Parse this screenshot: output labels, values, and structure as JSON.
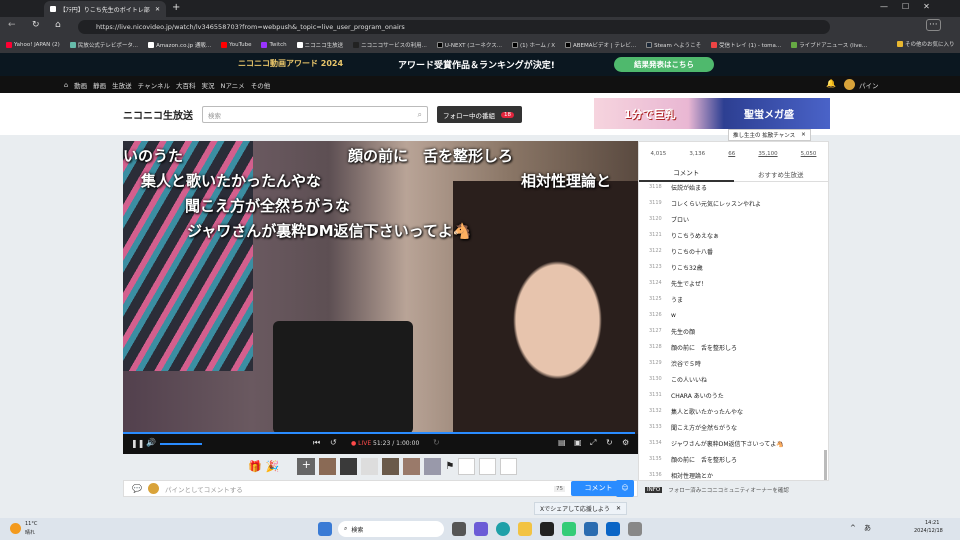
{
  "browser": {
    "tab_title": "【ｱﾃ円】りこち先生のボイトレ部",
    "url": "https://live.nicovideo.jp/watch/lv346558703?from=webpush&_topic=live_user_program_onairs",
    "bookmarks": [
      "Yahoo! JAPAN (2)",
      "民放公式テレビポータ...",
      "Amazon.co.jp 通販...",
      "YouTube",
      "Twitch",
      "ニコニコ生放送",
      "ニコニコサービスの利用...",
      "U-NEXT (ユーネクス...",
      "(1) ホーム / X",
      "ABEMAビデオ | テレビ...",
      "Steam へようこそ",
      "受信トレイ (1) - toma...",
      "ライブドアニュース (live..."
    ],
    "bookmarks_folder": "その他のお気に入り"
  },
  "banner": {
    "left": "ニコニコ動画アワード 2024",
    "center": "アワード受賞作品＆ランキングが決定!",
    "button": "結果発表はこちら"
  },
  "nav": {
    "items": [
      "動画",
      "静画",
      "生放送",
      "チャンネル",
      "大百科",
      "実況",
      "Nアニメ",
      "その他"
    ],
    "user": "パイン"
  },
  "header": {
    "logo": "ニコニコ生放送",
    "search_placeholder": "検索",
    "follow_label": "フォロー中の番組",
    "follow_count": "18",
    "ad_left": "1分で巨乳",
    "ad_right": "聖蛍メガ盛"
  },
  "captions": [
    "いのうた",
    "顔の前に　舌を整形しろ",
    "集人と歌いたかったんやな",
    "相対性理論と",
    "聞こえ方が全然ちがうな",
    "ジャワさんが裏粋DM返信下さいってよ🐴"
  ],
  "player": {
    "live": "LIVE",
    "time": "51:23 / 1:00:00"
  },
  "tooltip": "推し生主の 拡散チャンス",
  "stats": [
    "4,015",
    "3,136",
    "66",
    "35,100",
    "5,050"
  ],
  "tabs": [
    "コメント",
    "おすすめ生放送"
  ],
  "comments": [
    {
      "n": "3118",
      "t": "伝説が始まる"
    },
    {
      "n": "3119",
      "t": "コレくらい元気にレッスンやれよ"
    },
    {
      "n": "3120",
      "t": "ブロい"
    },
    {
      "n": "3121",
      "t": "りこちうめえなぁ"
    },
    {
      "n": "3122",
      "t": "りこちの十八番"
    },
    {
      "n": "3123",
      "t": "りこち32歳"
    },
    {
      "n": "3124",
      "t": "先生でよぜ！"
    },
    {
      "n": "3125",
      "t": "うま"
    },
    {
      "n": "3126",
      "t": "w"
    },
    {
      "n": "3127",
      "t": "先生の顔"
    },
    {
      "n": "3128",
      "t": "顔の前に　舌を整形しろ"
    },
    {
      "n": "3129",
      "t": "渋谷で５時"
    },
    {
      "n": "3130",
      "t": "この人いいね"
    },
    {
      "n": "3131",
      "t": "CHARA あいのうた"
    },
    {
      "n": "3132",
      "t": "集人と歌いたかったんやな"
    },
    {
      "n": "3133",
      "t": "聞こえ方が全然ちがうな"
    },
    {
      "n": "3134",
      "t": "ジャワさんが裏粋DM返信下さいってよ🐴"
    },
    {
      "n": "3135",
      "t": "顔の前に　舌を整形しろ"
    },
    {
      "n": "3136",
      "t": "相対性理論とか"
    }
  ],
  "comment_box": {
    "placeholder": "パインとしてコメントする",
    "count": "75",
    "submit": "コメント"
  },
  "info": {
    "badge": "INFO",
    "text": "フォロー済みニコニコミュニティオーナーを確認"
  },
  "share": "Xでシェアして応援しよう",
  "taskbar": {
    "temp": "11°C",
    "weather": "晴れ",
    "search": "検索",
    "time": "14:21",
    "date": "2024/12/18",
    "ime": "あ"
  }
}
